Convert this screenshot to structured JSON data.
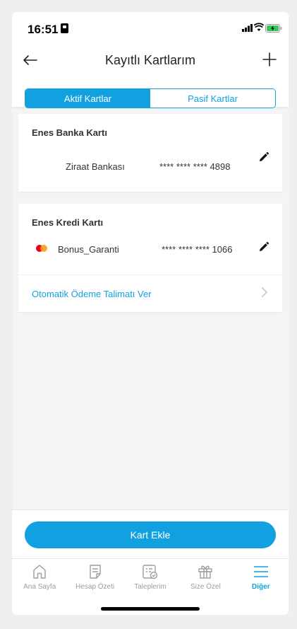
{
  "status": {
    "time": "16:51"
  },
  "header": {
    "title": "Kayıtlı Kartlarım"
  },
  "segment": {
    "active_label": "Aktif Kartlar",
    "inactive_label": "Pasif Kartlar"
  },
  "cards": [
    {
      "name": "Enes Banka Kartı",
      "bank": "Ziraat Bankası",
      "number": "**** **** **** 4898"
    },
    {
      "name": "Enes Kredi Kartı",
      "bank": "Bonus_Garanti",
      "number": "**** **** **** 1066",
      "action": "Otomatik Ödeme Talimatı Ver"
    }
  ],
  "footer": {
    "button_label": "Kart Ekle"
  },
  "tabs": [
    {
      "label": "Ana Sayfa",
      "icon": "home-icon"
    },
    {
      "label": "Hesap Özeti",
      "icon": "document-icon"
    },
    {
      "label": "Taleplerim",
      "icon": "requests-icon"
    },
    {
      "label": "Size Özel",
      "icon": "gift-icon"
    },
    {
      "label": "Diğer",
      "icon": "menu-icon"
    }
  ],
  "colors": {
    "accent": "#12a1e0",
    "background": "#f3f4f6",
    "mastercard_red": "#eb001b",
    "mastercard_orange": "#f79e1b"
  }
}
